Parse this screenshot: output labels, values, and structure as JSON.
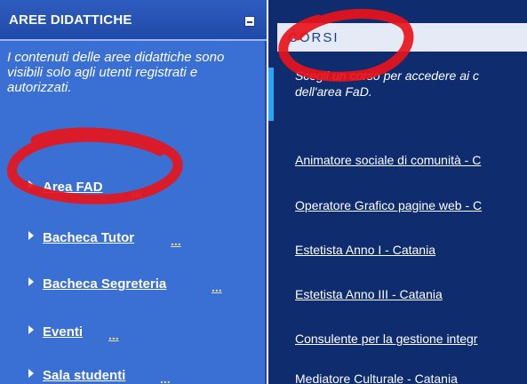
{
  "left_panel": {
    "title": "AREE DIDATTICHE",
    "description": "I contenuti delle aree didattiche sono visibili solo agli utenti registrati e autorizzati.",
    "items": [
      {
        "label": "Area FAD",
        "more": "..."
      },
      {
        "label": "Bacheca Tutor",
        "more": "..."
      },
      {
        "label": "Bacheca Segreteria",
        "more": "..."
      },
      {
        "label": "Eventi",
        "more": "..."
      },
      {
        "label": "Sala studenti",
        "more": "..."
      }
    ]
  },
  "right_panel": {
    "title": "CORSI",
    "description": "Scegli un corso per accedere ai c dell'area FaD.",
    "courses": [
      "Animatore sociale di comunità - C",
      "Operatore Grafico pagine web - C",
      "Estetista Anno I - Catania",
      "Estetista Anno III - Catania",
      "Consulente per la gestione integr",
      "Mediatore Culturale - Catania"
    ]
  },
  "colors": {
    "left_bg": "#3a6fd3",
    "right_bg": "#0f2d6e",
    "annotation_red": "#e8141b"
  }
}
